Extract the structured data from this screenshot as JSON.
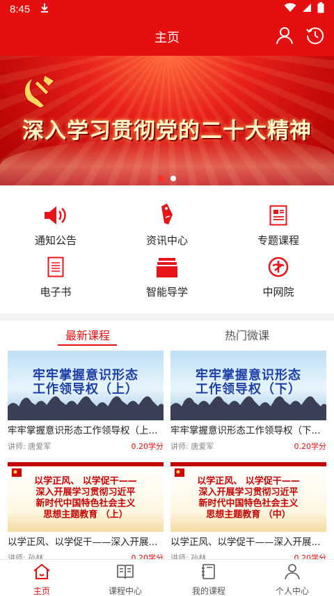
{
  "status_bar": {
    "time": "8:45"
  },
  "header": {
    "title": "主页"
  },
  "banner": {
    "slogan": "深入学习贯彻党的二十大精神",
    "slide_count": 2,
    "active_slide": 2
  },
  "menu": [
    {
      "label": "通知公告",
      "icon": "speaker-icon"
    },
    {
      "label": "资讯中心",
      "icon": "tag-icon"
    },
    {
      "label": "专题课程",
      "icon": "document-icon"
    },
    {
      "label": "电子书",
      "icon": "ebook-icon"
    },
    {
      "label": "智能导学",
      "icon": "stack-icon"
    },
    {
      "label": "中网院",
      "icon": "zwy-logo-icon"
    }
  ],
  "tabs": {
    "active": "最新课程",
    "inactive": "热门微课"
  },
  "courses": [
    {
      "thumb_text_1": "牢牢掌握意识形态",
      "thumb_text_2": "工作领导权（上）",
      "title": "牢牢掌握意识形态工作领导权（上...",
      "teacher": "讲师: 唐爱军",
      "credit": "0.20学分"
    },
    {
      "thumb_text_1": "牢牢掌握意识形态",
      "thumb_text_2": "工作领导权（下）",
      "title": "牢牢掌握意识形态工作领导权（下...",
      "teacher": "讲师: 唐爱军",
      "credit": "0.20学分"
    },
    {
      "thumb_text_1": "以学正风、 以学促干——",
      "thumb_text_2": "深入开展学习贯彻习近平",
      "thumb_text_3": "新时代中国特色社会主义",
      "thumb_text_4": "思想主题教育 （上）",
      "title": "以学正风、以学促干——深入开展...",
      "teacher": "讲师: 孙林",
      "credit": "0.20学分"
    },
    {
      "thumb_text_1": "以学正风、 以学促干——",
      "thumb_text_2": "深入开展学习贯彻习近平",
      "thumb_text_3": "新时代中国特色社会主义",
      "thumb_text_4": "思想主题教育 （中）",
      "title": "以学正风、以学促干——深入开展...",
      "teacher": "讲师: 孙林",
      "credit": "0.20学分"
    }
  ],
  "bottom_nav": [
    {
      "label": "主页",
      "icon": "home-icon",
      "active": true
    },
    {
      "label": "课程中心",
      "icon": "book-icon"
    },
    {
      "label": "我的课程",
      "icon": "notebook-icon"
    },
    {
      "label": "个人中心",
      "icon": "person-icon"
    }
  ],
  "colors": {
    "brand_red": "#e60f0f",
    "white": "#ffffff"
  }
}
